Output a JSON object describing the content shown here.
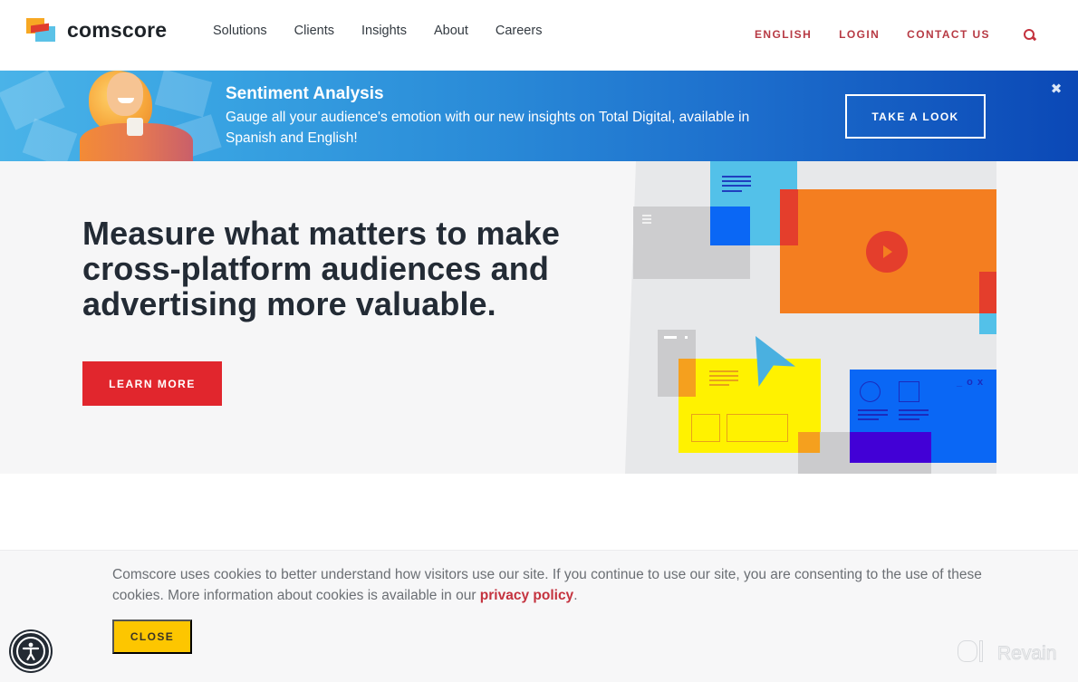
{
  "header": {
    "logo_text": "comscore",
    "nav": [
      {
        "label": "Solutions"
      },
      {
        "label": "Clients"
      },
      {
        "label": "Insights"
      },
      {
        "label": "About"
      },
      {
        "label": "Careers"
      }
    ],
    "utility_nav": [
      {
        "label": "ENGLISH"
      },
      {
        "label": "LOGIN"
      },
      {
        "label": "CONTACT US"
      }
    ],
    "search_icon": "search-icon"
  },
  "promo": {
    "title": "Sentiment Analysis",
    "description": "Gauge all your audience's emotion with our new insights on Total Digital, available in Spanish and English!",
    "button_label": "TAKE A LOOK",
    "close_glyph": "✖"
  },
  "hero": {
    "title": "Measure what matters to make cross-platform audiences and advertising more valuable.",
    "button_label": "LEARN MORE"
  },
  "illustration": {
    "window_controls": "_ o x"
  },
  "cookie": {
    "text_before": "Comscore uses cookies to better understand how visitors use our site. If you continue to use our site, you are consenting to the use of these cookies. More information about cookies is available in our ",
    "link_text": "privacy policy",
    "text_after": ".",
    "close_label": "CLOSE"
  },
  "watermark": {
    "text": "Revain"
  },
  "colors": {
    "brand_red": "#e1262d",
    "link_red": "#c4323e",
    "cookie_yellow": "#fdc600",
    "promo_blue_dark": "#0b48b6",
    "promo_blue_light": "#4ab3e8"
  }
}
